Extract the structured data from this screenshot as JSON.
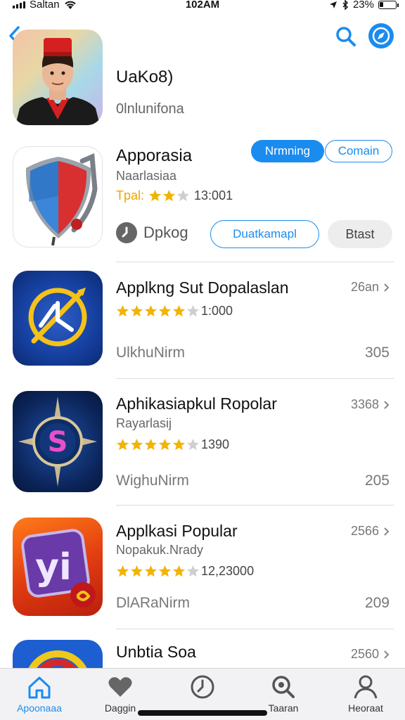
{
  "status": {
    "carrier": "Saltan",
    "time": "102AM",
    "battery": "23%",
    "battery_level": 0.23
  },
  "colors": {
    "accent": "#1a8cf0",
    "star": "#f2b400"
  },
  "header": {
    "title": "UaKo8)",
    "subtitle": "0lnlunifona"
  },
  "featured": {
    "title": "Apporasia",
    "subtitle": "Naarlasiaa",
    "rating_label": "Tpal:",
    "rating_stars": 2,
    "rating_count": "13:001",
    "primary_button": "Nrmning",
    "outline_button": "Comain",
    "tag_label": "Dpkog",
    "action_button": "Duatkamapl",
    "grey_button": "Btast"
  },
  "apps": [
    {
      "title": "Applkng Sut Dopalaslan",
      "subtitle": "",
      "stars": 5,
      "rating_count": "1:000",
      "meta": "UlkhuNirm",
      "right": "26an",
      "count": "305",
      "icon": "clock-arrow-icon"
    },
    {
      "title": "Aphikasiapkul Ropolar",
      "subtitle": "Rayarlasij",
      "stars": 5,
      "rating_count": "1390",
      "meta": "WighuNirm",
      "right": "3368",
      "count": "205",
      "icon": "compass-s-icon"
    },
    {
      "title": "Applkasi Popular",
      "subtitle": "Nopakuk.Nrady",
      "stars": 5,
      "rating_count": "12,23000",
      "meta": "DlARaNirm",
      "right": "2566",
      "count": "209",
      "icon": "yi-app-icon"
    },
    {
      "title": "Unbtia Soa",
      "subtitle": "",
      "stars": 0,
      "rating_count": "",
      "meta": "",
      "right": "2560",
      "count": "",
      "icon": "ring-app-icon"
    }
  ],
  "tabs": [
    {
      "label": "Apoonaaa",
      "icon": "home-icon",
      "active": true
    },
    {
      "label": "Daggin",
      "icon": "heart-icon",
      "active": false
    },
    {
      "label": "",
      "icon": "clock-icon",
      "active": false
    },
    {
      "label": "Taaran",
      "icon": "search-icon",
      "active": false
    },
    {
      "label": "Heoraat",
      "icon": "person-icon",
      "active": false
    }
  ]
}
